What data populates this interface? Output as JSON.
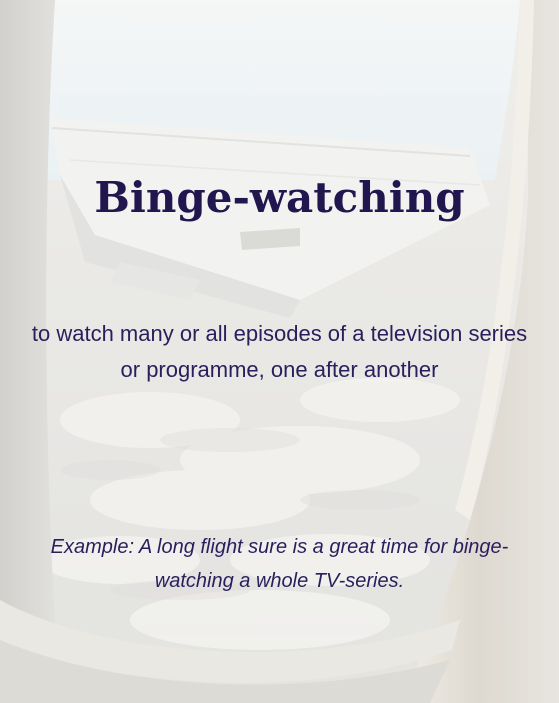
{
  "card": {
    "title": "Binge-watching",
    "definition": "to watch many or all episodes of a television series or programme, one after another",
    "example": "Example: A long flight sure is a great time for binge-watching a whole TV-series."
  },
  "colors": {
    "text": "#2a1f5c",
    "title": "#22164f",
    "sky": "#eaf2f7",
    "cloud": "#f2f1ee",
    "frame": "#dedbd3"
  },
  "background": {
    "image": "airplane-window-wing-icon"
  }
}
